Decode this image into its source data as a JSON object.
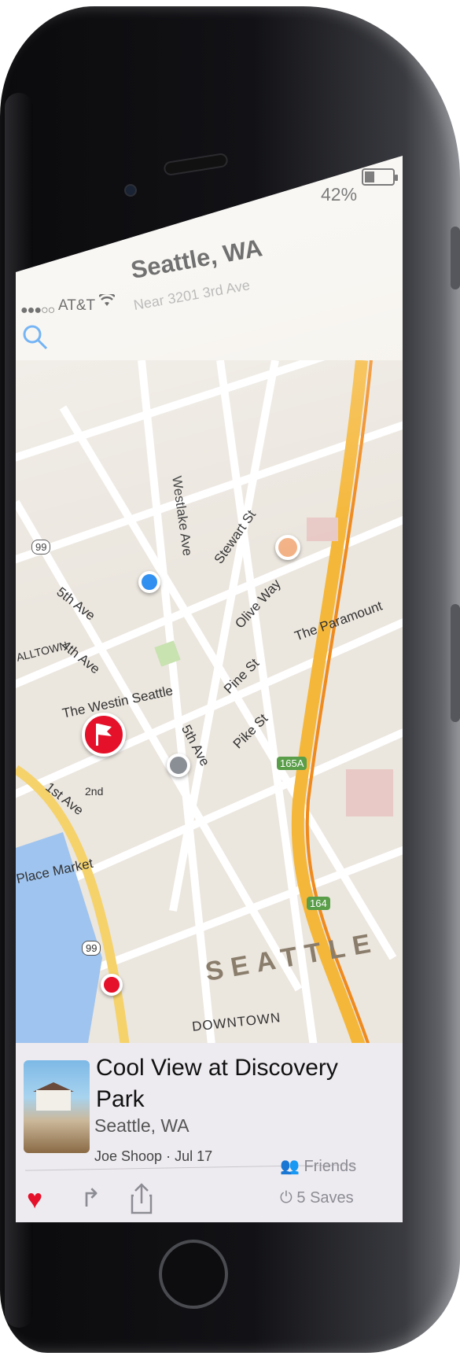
{
  "status_bar": {
    "signal": "●●●○○",
    "carrier": "AT&T",
    "battery": "42%"
  },
  "header": {
    "title": "Seattle, WA",
    "subtitle": "Near 3201 3rd Ave"
  },
  "map": {
    "streets": [
      "Westlake Ave",
      "Stewart St",
      "5th Ave",
      "Olive Way",
      "4th Ave",
      "Pine St",
      "5th Ave",
      "Pike St",
      "1st Ave"
    ],
    "places": [
      "The Westin Seattle",
      "The Paramount",
      "Place Market",
      "DOWNTOWN"
    ],
    "highways": [
      "99",
      "99",
      "165A",
      "164"
    ],
    "city_label": "SEATTLE",
    "district_label": "ALLTOWN",
    "partial_street": "2nd",
    "pins": [
      {
        "color": "#2f8ff0"
      },
      {
        "color": "#f3b286"
      },
      {
        "color": "#8a8e95"
      },
      {
        "color": "#e5102a"
      },
      {
        "color": "#e5102a"
      }
    ]
  },
  "card": {
    "title": "Cool View at Discovery Park",
    "location": "Seattle, WA",
    "author": "Joe Shoop",
    "date": "Jul 17",
    "separator": "·",
    "friends_label": "Friends",
    "saves_label": "5 Saves"
  },
  "colors": {
    "accent": "#e5102a",
    "search": "#2f8ff0",
    "highway": "#f5b73a"
  }
}
